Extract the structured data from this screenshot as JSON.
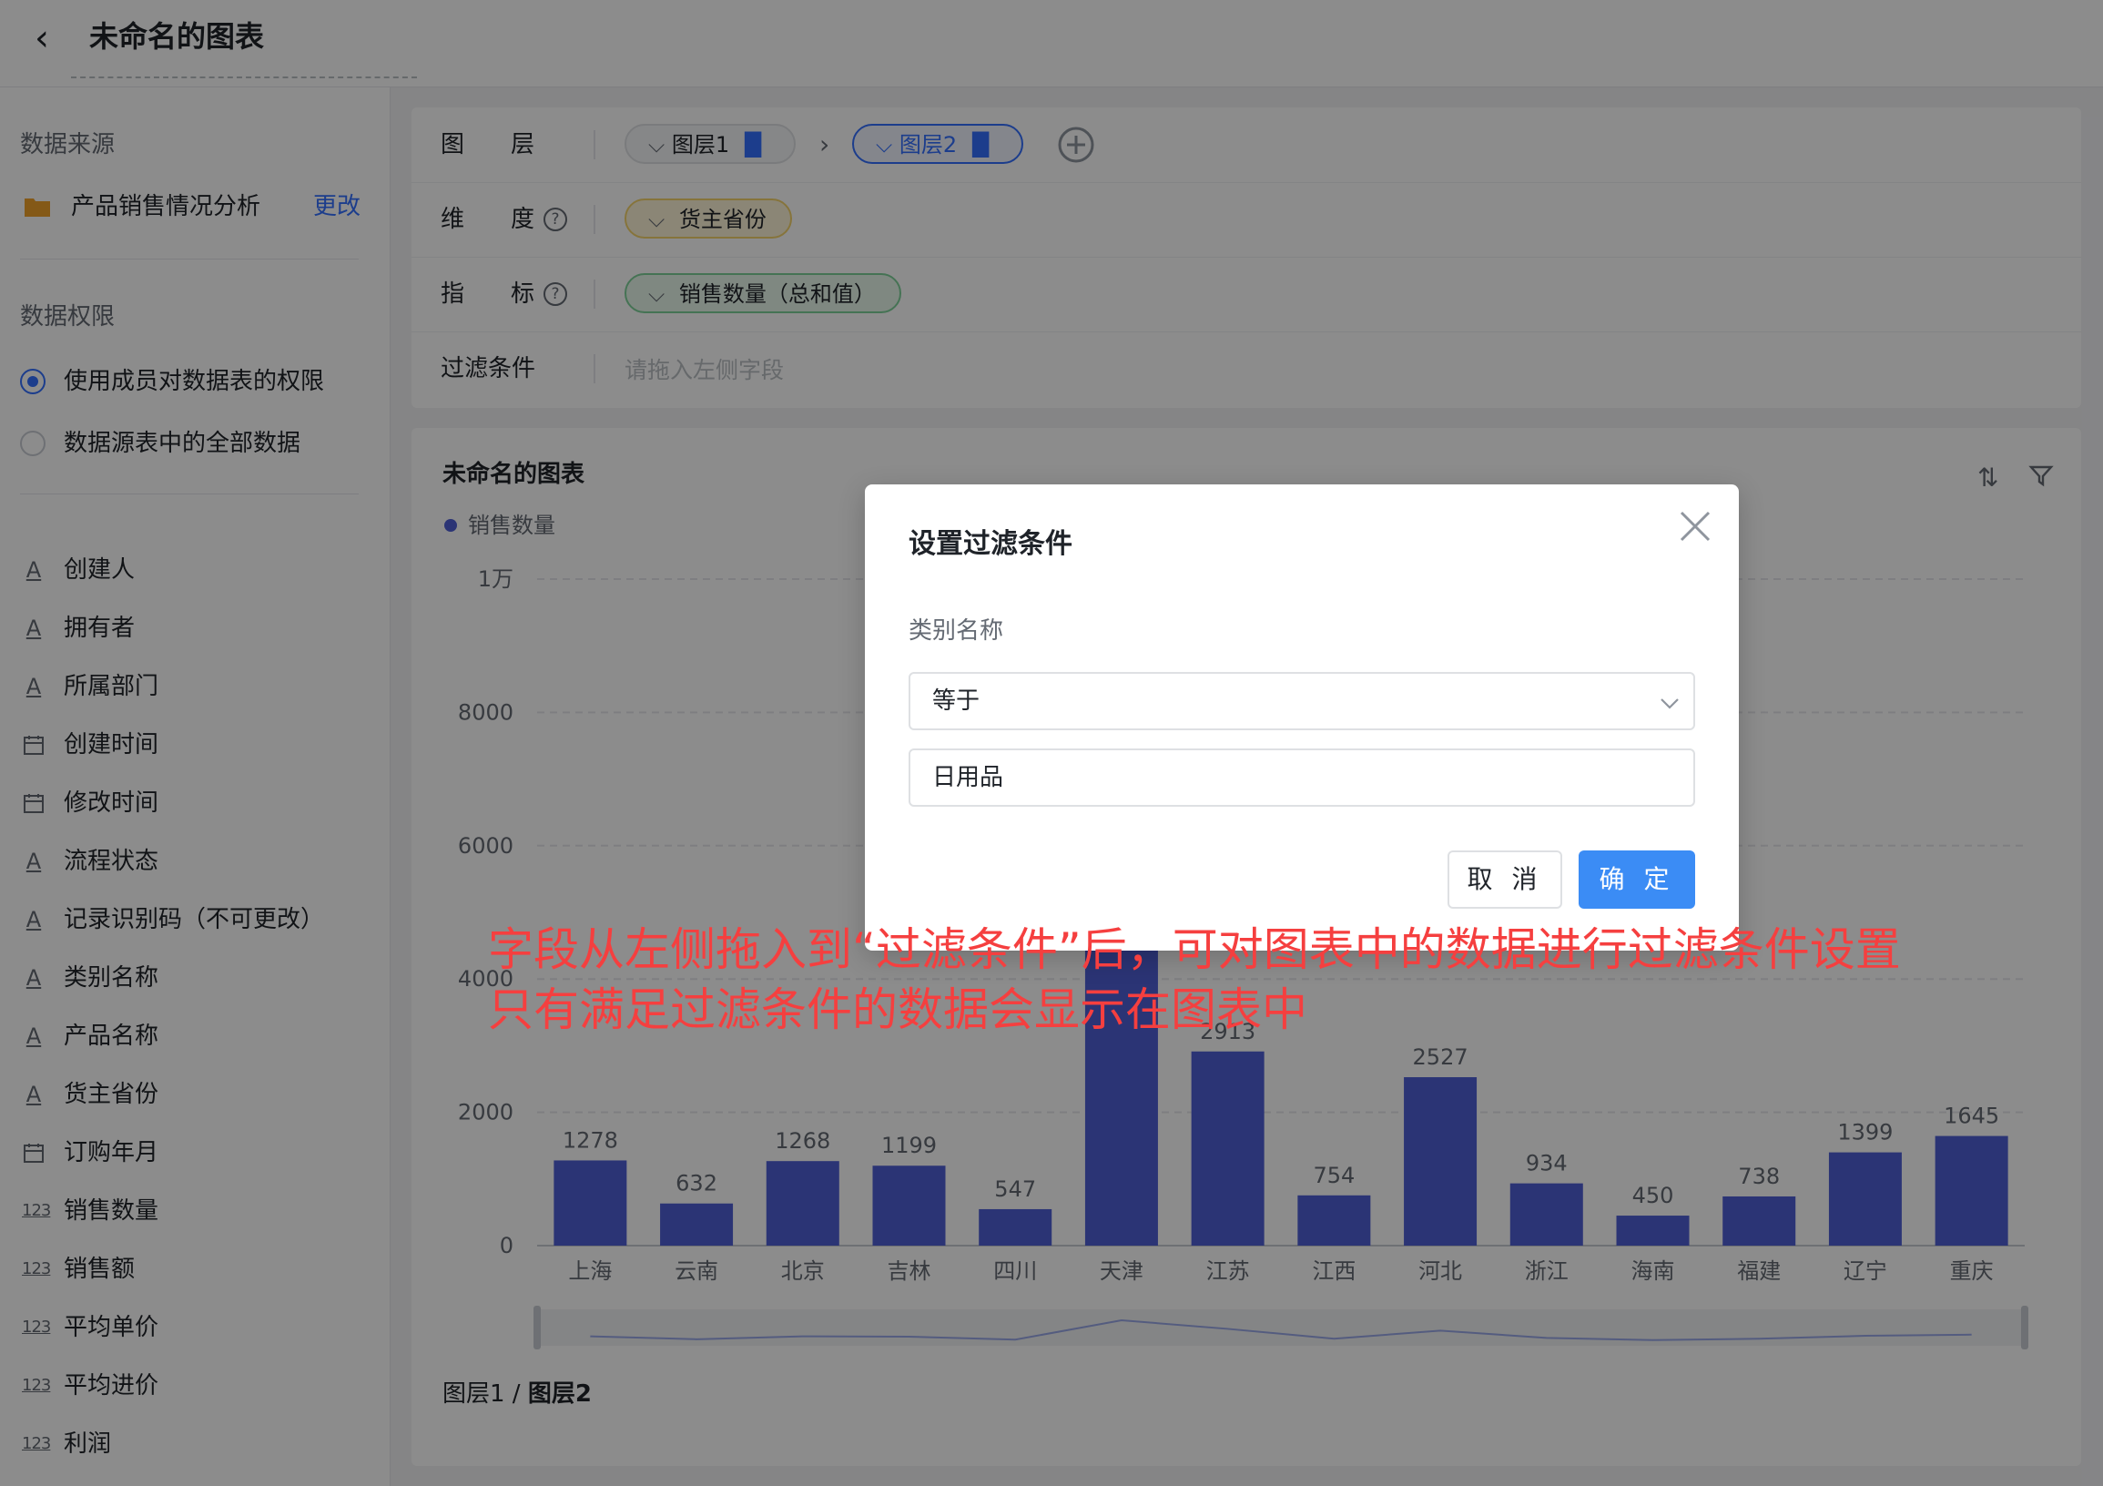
{
  "header": {
    "back_icon": "chevron-left-icon",
    "title": "未命名的图表"
  },
  "sidebar": {
    "datasource_heading": "数据来源",
    "datasource_name": "产品销售情况分析",
    "datasource_change": "更改",
    "permission_heading": "数据权限",
    "permission_options": [
      {
        "label": "使用成员对数据表的权限",
        "selected": true
      },
      {
        "label": "数据源表中的全部数据",
        "selected": false
      }
    ],
    "fields": [
      {
        "type": "text",
        "label": "创建人"
      },
      {
        "type": "text",
        "label": "拥有者"
      },
      {
        "type": "text",
        "label": "所属部门"
      },
      {
        "type": "date",
        "label": "创建时间"
      },
      {
        "type": "date",
        "label": "修改时间"
      },
      {
        "type": "text",
        "label": "流程状态"
      },
      {
        "type": "text",
        "label": "记录识别码（不可更改）"
      },
      {
        "type": "text",
        "label": "类别名称"
      },
      {
        "type": "text",
        "label": "产品名称"
      },
      {
        "type": "text",
        "label": "货主省份"
      },
      {
        "type": "date",
        "label": "订购年月"
      },
      {
        "type": "number",
        "label": "销售数量"
      },
      {
        "type": "number",
        "label": "销售额"
      },
      {
        "type": "number",
        "label": "平均单价"
      },
      {
        "type": "number",
        "label": "平均进价"
      },
      {
        "type": "number",
        "label": "利润"
      }
    ]
  },
  "config": {
    "layer_label": [
      "图",
      "层"
    ],
    "layer1": "图层1",
    "layer2": "图层2",
    "dimension_label": [
      "维",
      "度"
    ],
    "dimension_value": "货主省份",
    "metric_label": [
      "指",
      "标"
    ],
    "metric_value": "销售数量（总和值）",
    "filter_label": "过滤条件",
    "filter_placeholder": "请拖入左侧字段"
  },
  "chart_card": {
    "title": "未命名的图表",
    "footer_layer1": "图层1",
    "footer_sep": " / ",
    "footer_layer2": "图层2",
    "sort_icon": "sort-icon",
    "filter_icon": "filter-icon"
  },
  "chart_data": {
    "type": "bar",
    "legend": "销售数量",
    "categories": [
      "上海",
      "云南",
      "北京",
      "吉林",
      "四川",
      "天津",
      "江苏",
      "江西",
      "河北",
      "浙江",
      "海南",
      "福建",
      "辽宁",
      "重庆"
    ],
    "values": [
      1278,
      632,
      1268,
      1199,
      547,
      4800,
      2913,
      754,
      2527,
      934,
      450,
      738,
      1399,
      1645
    ],
    "labels": [
      "1278",
      "632",
      "1268",
      "1199",
      "547",
      "",
      "2913",
      "754",
      "2527",
      "934",
      "450",
      "738",
      "1399",
      "1645"
    ],
    "ylim": [
      0,
      10000
    ],
    "yticks": [
      0,
      2000,
      4000,
      6000,
      8000,
      10000
    ],
    "ytick_labels": [
      "0",
      "2000",
      "4000",
      "6000",
      "8000",
      "1万"
    ],
    "color": "#4f5fd6"
  },
  "modal": {
    "title": "设置过滤条件",
    "field_label": "类别名称",
    "operator": "等于",
    "value": "日用品",
    "cancel": "取 消",
    "confirm": "确 定"
  },
  "annotation": {
    "line1": "字段从左侧拖入到“过滤条件”后，可对图表中的数据进行过滤条件设置",
    "line2": "只有满足过滤条件的数据会显示在图表中"
  },
  "colors": {
    "accent": "#3370ff",
    "bar": "#4f5fd6",
    "annotation": "#f53f3f"
  }
}
